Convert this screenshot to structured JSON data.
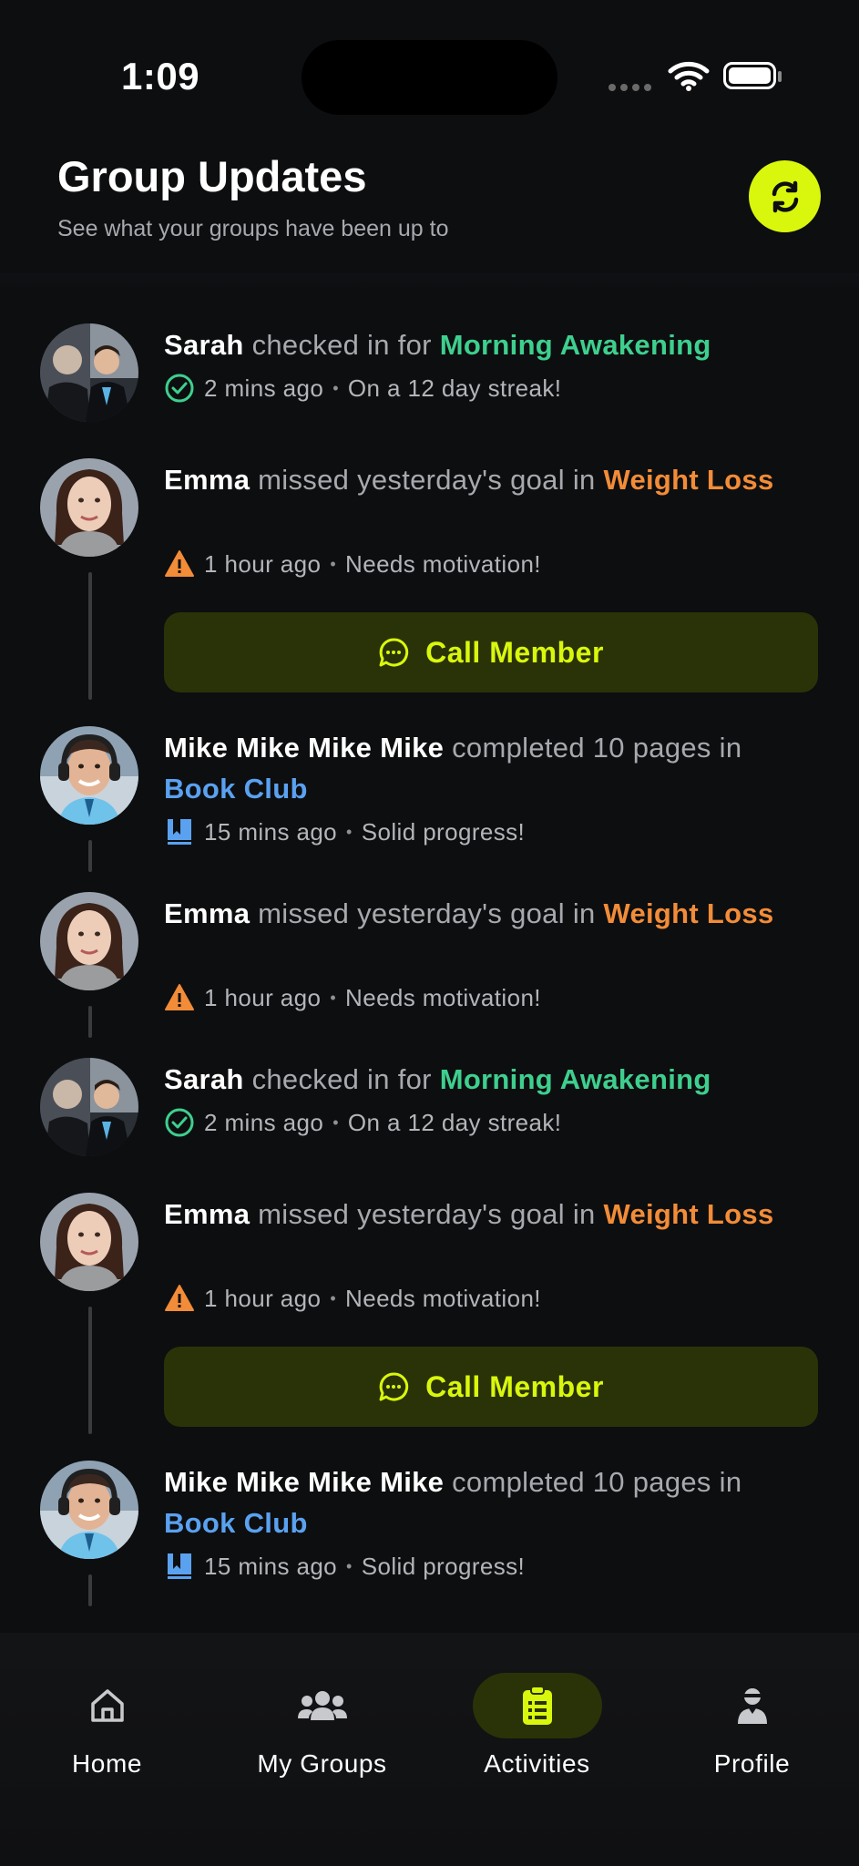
{
  "status_bar": {
    "time": "1:09"
  },
  "header": {
    "title": "Group Updates",
    "subtitle": "See what your groups have been up to",
    "refresh_icon": "refresh-icon"
  },
  "colors": {
    "accent": "#d9f70d",
    "green": "#3ecf8e",
    "orange": "#f28c38",
    "blue": "#5aa1f0",
    "background": "#0d0e10"
  },
  "feed": [
    {
      "name": "Sarah",
      "action": " checked in for ",
      "group": "Morning Awakening",
      "group_color": "green",
      "icon": "check-circle-icon",
      "time": "2 mins ago",
      "note": "On a 12 day streak!"
    },
    {
      "name": "Emma",
      "action": " missed yesterday's goal in ",
      "group": "Weight Loss",
      "group_color": "orange",
      "icon": "warning-icon",
      "time": "1 hour ago",
      "note": "Needs motivation!",
      "button": "Call Member"
    },
    {
      "name": "Mike Mike Mike Mike",
      "action": " completed 10 pages in ",
      "group": "Book Club",
      "group_color": "blue",
      "icon": "book-icon",
      "time": "15 mins ago",
      "note": "Solid progress!"
    },
    {
      "name": "Emma",
      "action": " missed yesterday's goal in ",
      "group": "Weight Loss",
      "group_color": "orange",
      "icon": "warning-icon",
      "time": "1 hour ago",
      "note": "Needs motivation!"
    },
    {
      "name": "Sarah",
      "action": " checked in for ",
      "group": "Morning Awakening",
      "group_color": "green",
      "icon": "check-circle-icon",
      "time": "2 mins ago",
      "note": "On a 12 day streak!"
    },
    {
      "name": "Emma",
      "action": " missed yesterday's goal in ",
      "group": "Weight Loss",
      "group_color": "orange",
      "icon": "warning-icon",
      "time": "1 hour ago",
      "note": "Needs motivation!",
      "button": "Call Member"
    },
    {
      "name": "Mike Mike Mike Mike",
      "action": " completed 10 pages in ",
      "group": "Book Club",
      "group_color": "blue",
      "icon": "book-icon",
      "time": "15 mins ago",
      "note": "Solid progress!"
    }
  ],
  "tabs": [
    {
      "label": "Home",
      "icon": "home-icon",
      "active": false
    },
    {
      "label": "My Groups",
      "icon": "users-icon",
      "active": false
    },
    {
      "label": "Activities",
      "icon": "clipboard-icon",
      "active": true
    },
    {
      "label": "Profile",
      "icon": "profile-icon",
      "active": false
    }
  ]
}
